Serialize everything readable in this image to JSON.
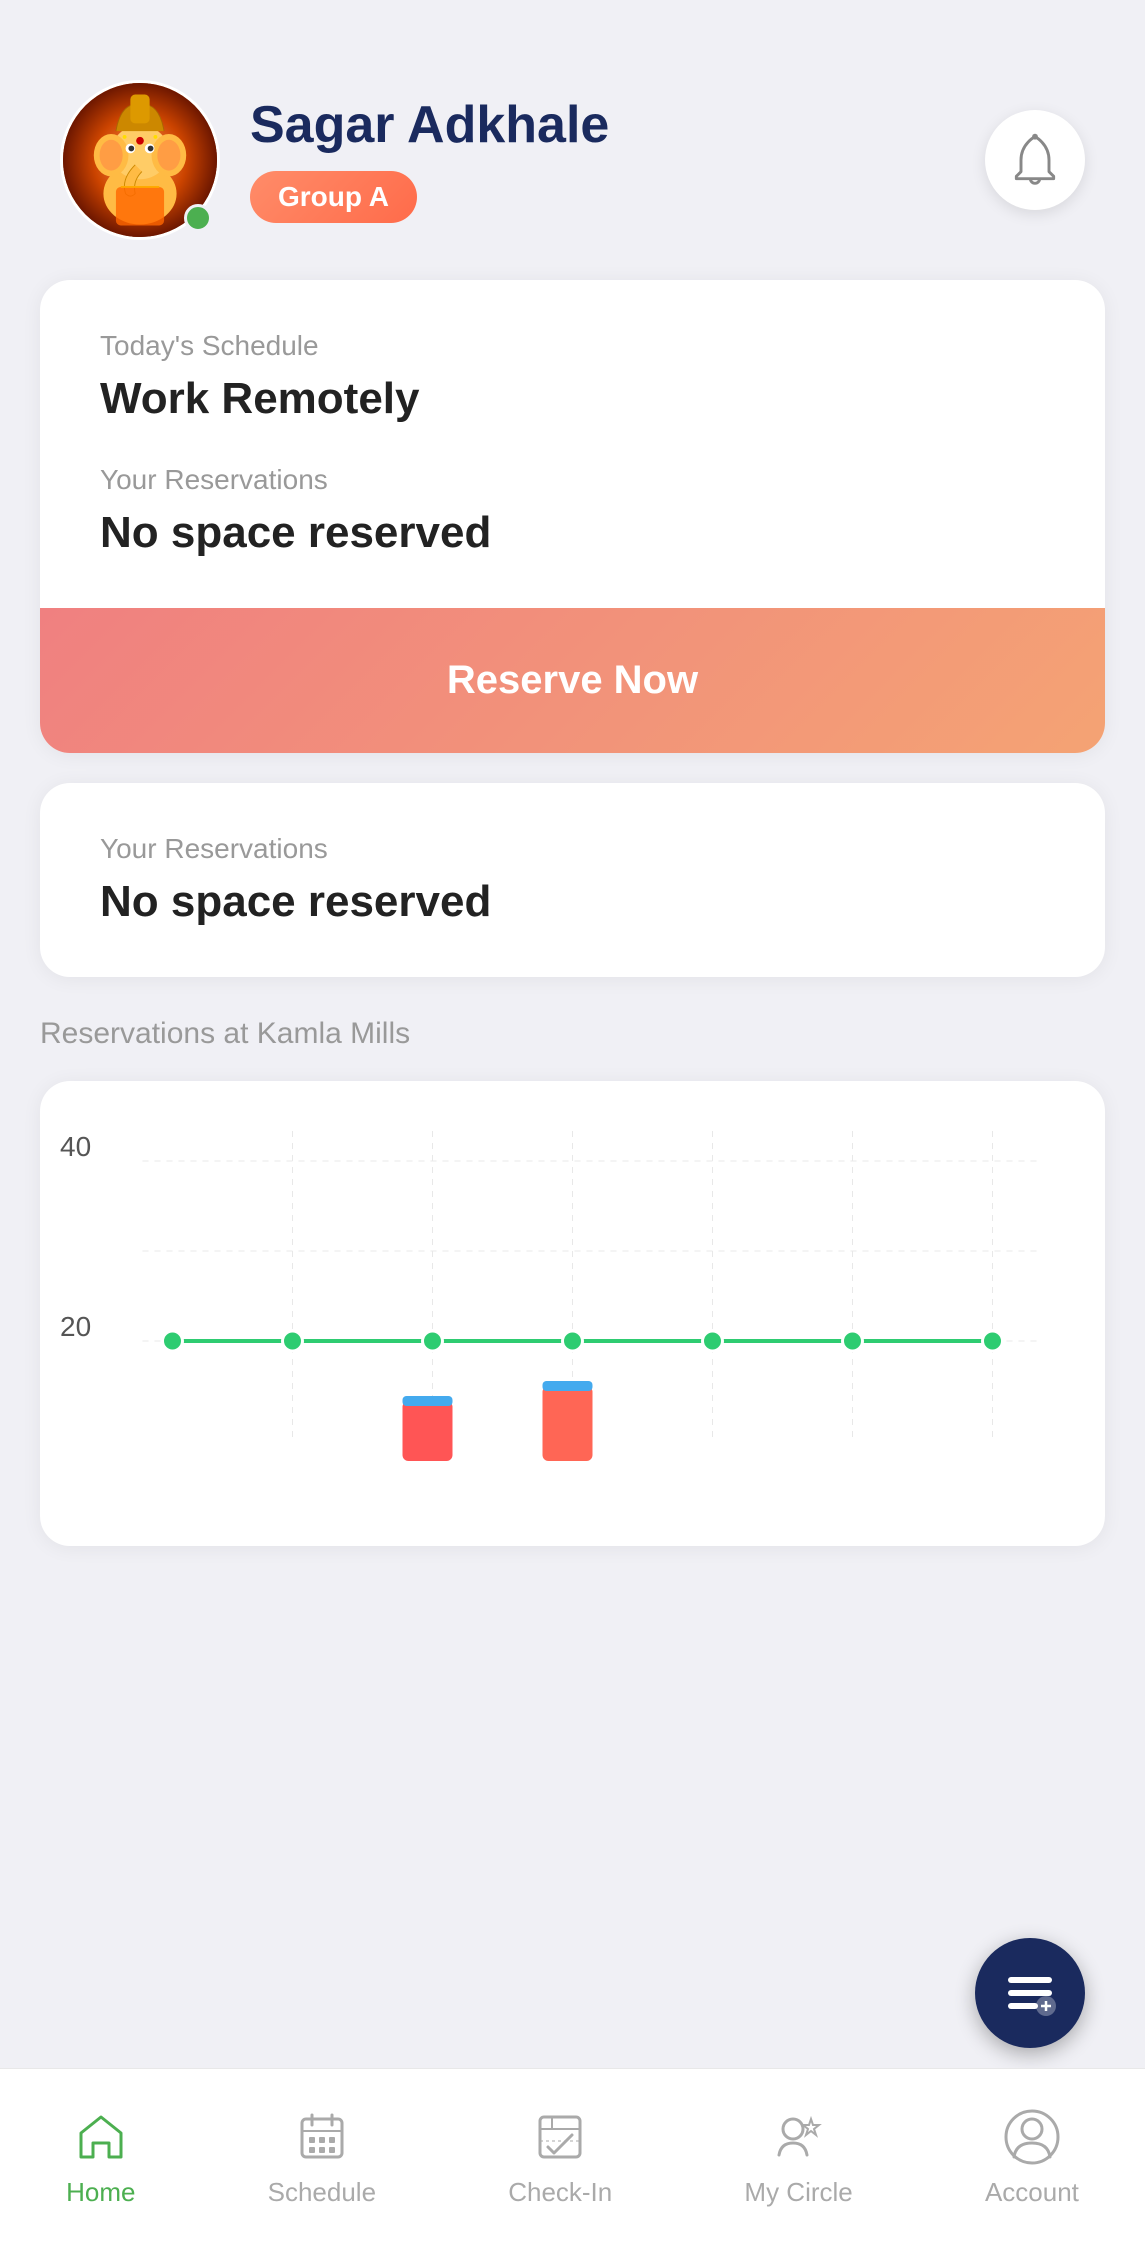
{
  "header": {
    "user_name": "Sagar Adkhale",
    "group_badge": "Group A",
    "online_status": true
  },
  "schedule_card": {
    "today_label": "Today's Schedule",
    "today_value": "Work Remotely",
    "reservations_label": "Your Reservations",
    "reservations_value": "No space reserved",
    "reserve_button": "Reserve Now"
  },
  "reservations_card": {
    "label": "Your Reservations",
    "value": "No space reserved"
  },
  "chart": {
    "title": "Reservations at Kamla Mills",
    "y_max": "40",
    "y_mid": "20",
    "data_points": [
      22,
      22,
      22,
      22,
      22,
      22
    ],
    "bar_values": [
      5,
      8
    ]
  },
  "bottom_nav": {
    "items": [
      {
        "id": "home",
        "label": "Home",
        "active": true
      },
      {
        "id": "schedule",
        "label": "Schedule",
        "active": false
      },
      {
        "id": "checkin",
        "label": "Check-In",
        "active": false
      },
      {
        "id": "mycircle",
        "label": "My Circle",
        "active": false
      },
      {
        "id": "account",
        "label": "Account",
        "active": false
      }
    ]
  }
}
